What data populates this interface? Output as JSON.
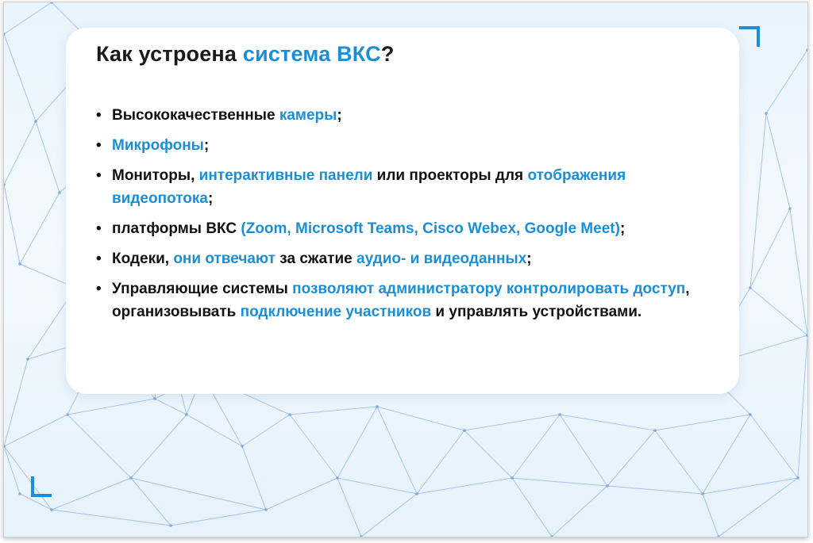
{
  "slide": {
    "title": [
      {
        "text": "Как устроена ",
        "hl": false
      },
      {
        "text": "система ВКС",
        "hl": true
      },
      {
        "text": "?",
        "hl": false
      }
    ],
    "bullet_symbol": "•",
    "bullets": [
      [
        {
          "text": "Высококачественные ",
          "hl": false
        },
        {
          "text": "камеры",
          "hl": true
        },
        {
          "text": ";",
          "hl": false
        }
      ],
      [
        {
          "text": "Микрофоны",
          "hl": true
        },
        {
          "text": ";",
          "hl": false
        }
      ],
      [
        {
          "text": "Мониторы, ",
          "hl": false
        },
        {
          "text": "интерактивные панели",
          "hl": true
        },
        {
          "text": " или проекторы для ",
          "hl": false
        },
        {
          "text": "отображения видеопотока",
          "hl": true
        },
        {
          "text": ";",
          "hl": false
        }
      ],
      [
        {
          "text": "платформы ВКС ",
          "hl": false
        },
        {
          "text": "(Zoom, Microsoft Teams, Cisco Webex, Google Meet)",
          "hl": true
        },
        {
          "text": ";",
          "hl": false
        }
      ],
      [
        {
          "text": "Кодеки, ",
          "hl": false
        },
        {
          "text": "они отвечают",
          "hl": true
        },
        {
          "text": " за сжатие ",
          "hl": false
        },
        {
          "text": "аудио- и видеоданных",
          "hl": true
        },
        {
          "text": ";",
          "hl": false
        }
      ],
      [
        {
          "text": "Управляющие системы ",
          "hl": false
        },
        {
          "text": "позволяют администратору контролировать доступ",
          "hl": true
        },
        {
          "text": ", организовывать ",
          "hl": false
        },
        {
          "text": "подключение участников",
          "hl": true
        },
        {
          "text": " и управлять устройствами.",
          "hl": false
        }
      ]
    ]
  },
  "colors": {
    "accent": "#1a8fd8",
    "text": "#111111",
    "corner_marks": "#1b8fdc",
    "background": "#eaf4fd",
    "mesh_lines": "#8fb4e6"
  },
  "icons": [
    "corner-bracket-top-right",
    "corner-bracket-bottom-left"
  ]
}
